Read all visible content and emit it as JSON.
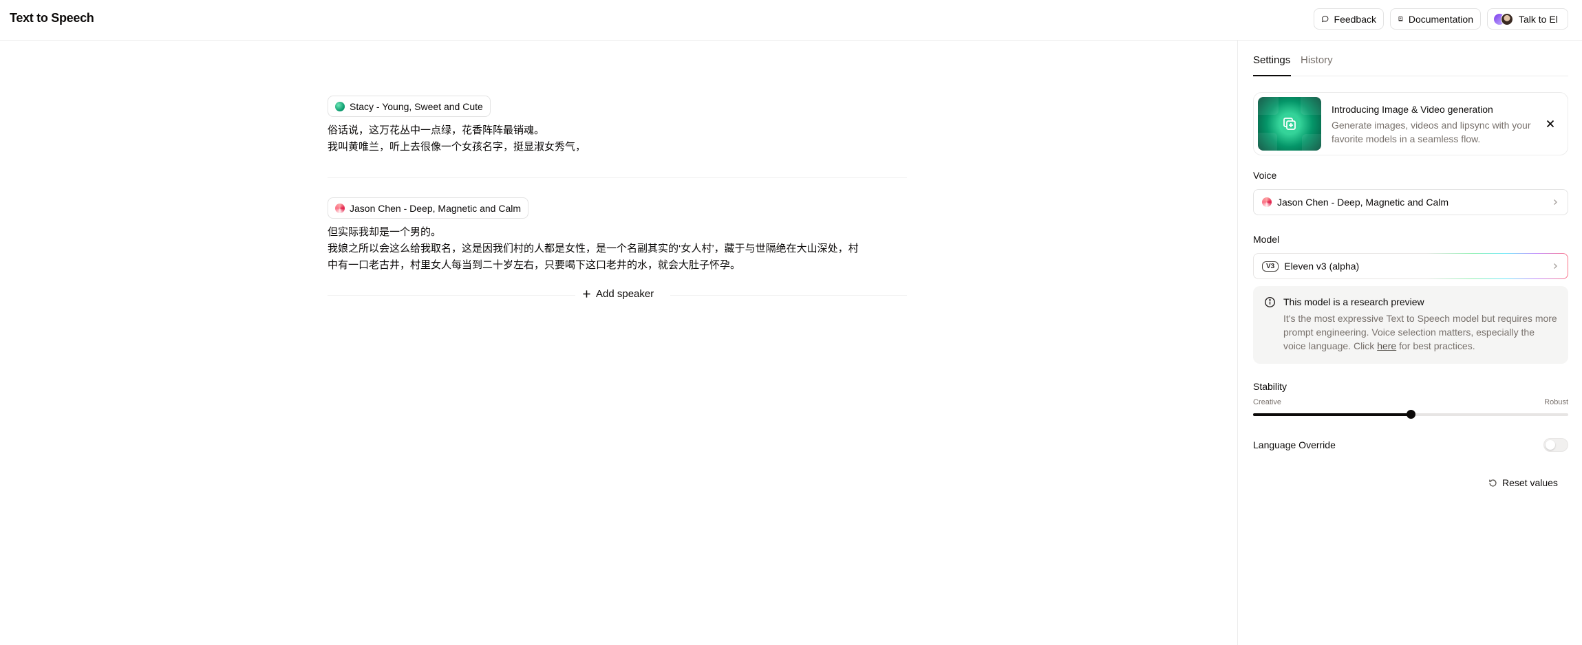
{
  "header": {
    "title": "Text to Speech",
    "feedback_label": "Feedback",
    "documentation_label": "Documentation",
    "talk_label": "Talk to El"
  },
  "editor": {
    "blocks": [
      {
        "voice": "Stacy - Young, Sweet and Cute",
        "text": "俗话说，这万花丛中一点绿，花香阵阵最销魂。\n我叫黄唯兰，听上去很像一个女孩名字，挺显淑女秀气，"
      },
      {
        "voice": "Jason Chen - Deep, Magnetic and Calm",
        "text": "但实际我却是一个男的。\n我娘之所以会这么给我取名，这是因我们村的人都是女性，是一个名副其实的‘女人村’，藏于与世隔绝在大山深处，村\n中有一口老古井，村里女人每当到二十岁左右，只要喝下这口老井的水，就会大肚子怀孕。"
      }
    ],
    "add_speaker_label": "Add speaker"
  },
  "panel": {
    "tabs": [
      "Settings",
      "History"
    ],
    "active_tab": "Settings",
    "promo": {
      "title": "Introducing Image & Video generation",
      "text": "Generate images, videos and lipsync with your favorite models in a seamless flow."
    },
    "voice_label": "Voice",
    "voice_value": "Jason Chen - Deep, Magnetic and Calm",
    "model_label": "Model",
    "model_badge": "V3",
    "model_value": "Eleven v3 (alpha)",
    "info": {
      "title": "This model is a research preview",
      "text_before": "It's the most expressive Text to Speech model but requires more prompt engineering. Voice selection matters, especially the voice language. Click ",
      "link": "here",
      "text_after": " for best practices."
    },
    "stability": {
      "label": "Stability",
      "min_label": "Creative",
      "max_label": "Robust",
      "value": 0.5
    },
    "language_override": {
      "label": "Language Override",
      "enabled": false
    },
    "reset_label": "Reset values"
  },
  "colors": {
    "text": "#0c0a09",
    "muted": "#78716c",
    "border": "#e3e3e3",
    "accent_green": "#059669"
  }
}
